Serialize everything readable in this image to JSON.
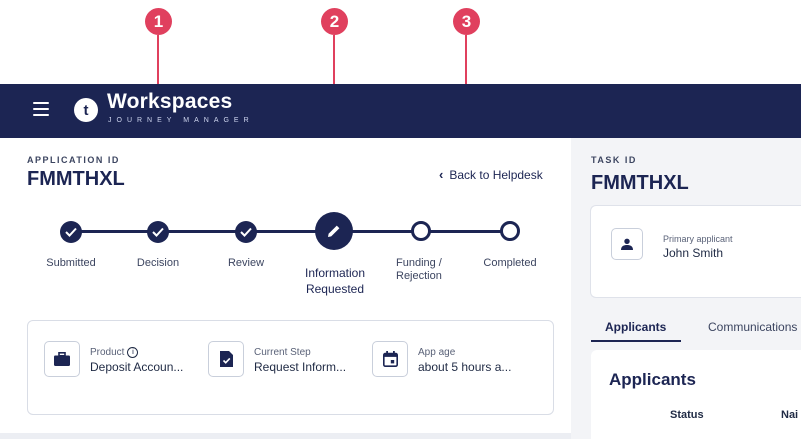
{
  "callouts": [
    "1",
    "2",
    "3"
  ],
  "header": {
    "logo_letter": "t",
    "brand_title": "Workspaces",
    "brand_subtitle": "JOURNEY MANAGER"
  },
  "application": {
    "label": "APPLICATION ID",
    "id": "FMMTHXL",
    "back_link": "Back to Helpdesk"
  },
  "stepper": {
    "steps": [
      {
        "label": "Submitted",
        "state": "done"
      },
      {
        "label": "Decision",
        "state": "done"
      },
      {
        "label": "Review",
        "state": "done"
      },
      {
        "label_line1": "Information",
        "label_line2": "Requested",
        "state": "active"
      },
      {
        "label_line1": "Funding /",
        "label_line2": "Rejection",
        "state": "todo"
      },
      {
        "label": "Completed",
        "state": "todo"
      }
    ]
  },
  "info": {
    "product": {
      "caption": "Product",
      "value": "Deposit Accoun..."
    },
    "current_step": {
      "caption": "Current Step",
      "value": "Request Inform..."
    },
    "app_age": {
      "caption": "App age",
      "value": "about 5 hours a..."
    }
  },
  "task": {
    "label": "TASK ID",
    "id": "FMMTHXL",
    "primary_caption": "Primary applicant",
    "primary_name": "John Smith"
  },
  "tabs": {
    "applicants": "Applicants",
    "communications": "Communications"
  },
  "applicants_card": {
    "title": "Applicants",
    "columns": [
      "Status",
      "Nai"
    ]
  },
  "colors": {
    "navy": "#1c2553",
    "callout": "#e0405e",
    "panel_bg": "#f3f4f7"
  }
}
